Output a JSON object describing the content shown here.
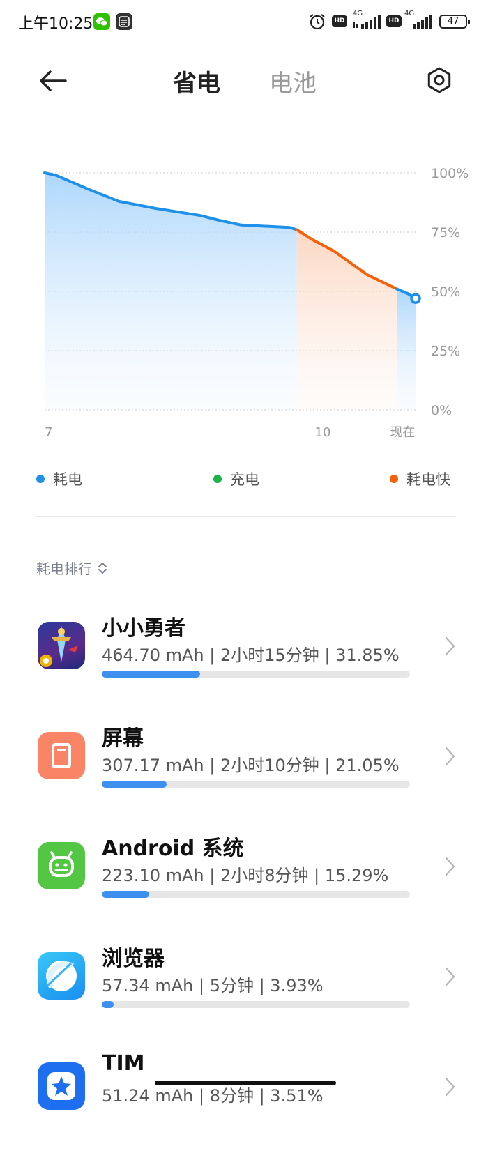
{
  "status_bar": {
    "time": "上午10:25",
    "battery_level": "47",
    "network_1": "4G",
    "network_2": "4G",
    "hd_label": "HD"
  },
  "header": {
    "tabs": [
      {
        "label": "省电",
        "active": true
      },
      {
        "label": "电池",
        "active": false
      }
    ]
  },
  "chart_data": {
    "type": "area",
    "x_tick_labels": [
      "7",
      "10",
      "现在"
    ],
    "y_tick_labels": [
      "100%",
      "75%",
      "50%",
      "25%",
      "0%"
    ],
    "ylim": [
      0,
      100
    ],
    "grid": true,
    "series": [
      {
        "name": "耗电",
        "color": "#1e90e8",
        "points": [
          [
            0.0,
            100
          ],
          [
            0.03,
            99
          ],
          [
            0.12,
            93
          ],
          [
            0.2,
            88
          ],
          [
            0.3,
            85
          ],
          [
            0.42,
            82
          ],
          [
            0.47,
            80
          ],
          [
            0.53,
            78
          ],
          [
            0.66,
            77
          ],
          [
            0.68,
            76
          ]
        ]
      },
      {
        "name": "耗电快",
        "color": "#f4600c",
        "points": [
          [
            0.68,
            76
          ],
          [
            0.72,
            72
          ],
          [
            0.78,
            67
          ],
          [
            0.87,
            57
          ],
          [
            0.95,
            51
          ]
        ]
      },
      {
        "name": "耗电",
        "color": "#1e90e8",
        "points": [
          [
            0.95,
            51
          ],
          [
            0.98,
            49
          ],
          [
            1.0,
            47
          ]
        ]
      }
    ]
  },
  "legend": [
    {
      "label": "耗电",
      "color": "#1e90e8"
    },
    {
      "label": "充电",
      "color": "#19b54a"
    },
    {
      "label": "耗电快",
      "color": "#f4600c"
    }
  ],
  "ranking": {
    "title": "耗电排行",
    "apps": [
      {
        "name": "小小勇者",
        "stats": "464.70 mAh | 2小时15分钟 | 31.85%",
        "percent": 31.85,
        "icon": "game-icon"
      },
      {
        "name": "屏幕",
        "stats": "307.17 mAh | 2小时10分钟 | 21.05%",
        "percent": 21.05,
        "icon": "screen-icon"
      },
      {
        "name": "Android 系统",
        "stats": "223.10 mAh | 2小时8分钟 | 15.29%",
        "percent": 15.29,
        "icon": "android-icon"
      },
      {
        "name": "浏览器",
        "stats": "57.34 mAh | 5分钟 | 3.93%",
        "percent": 3.93,
        "icon": "browser-icon"
      },
      {
        "name": "TIM",
        "stats": "51.24 mAh | 8分钟 | 3.51%",
        "percent": 3.51,
        "icon": "tim-icon"
      }
    ]
  }
}
